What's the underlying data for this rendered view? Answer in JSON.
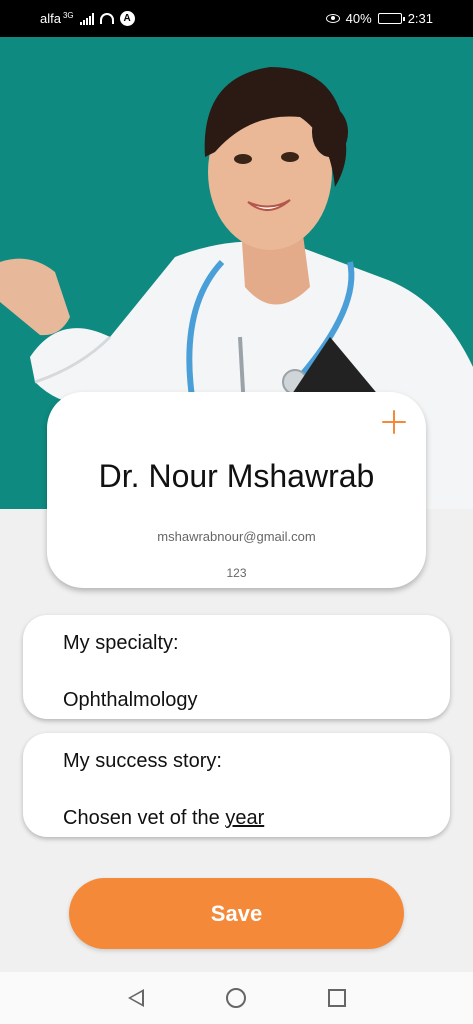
{
  "status_bar": {
    "carrier": "alfa",
    "network": "3G",
    "battery_percent": "40%",
    "battery_level": 0.4,
    "time": "2:31"
  },
  "profile": {
    "name": "Dr. Nour Mshawrab",
    "email": "mshawrabnour@gmail.com",
    "code": "123"
  },
  "specialty": {
    "label": "My specialty:",
    "value": "Ophthalmology"
  },
  "story": {
    "label": "My success story:",
    "value_main": "Chosen vet of the ",
    "value_underlined": "year"
  },
  "actions": {
    "save_label": "Save"
  },
  "colors": {
    "accent": "#f5893a",
    "hero_bg": "#0e8a80"
  }
}
